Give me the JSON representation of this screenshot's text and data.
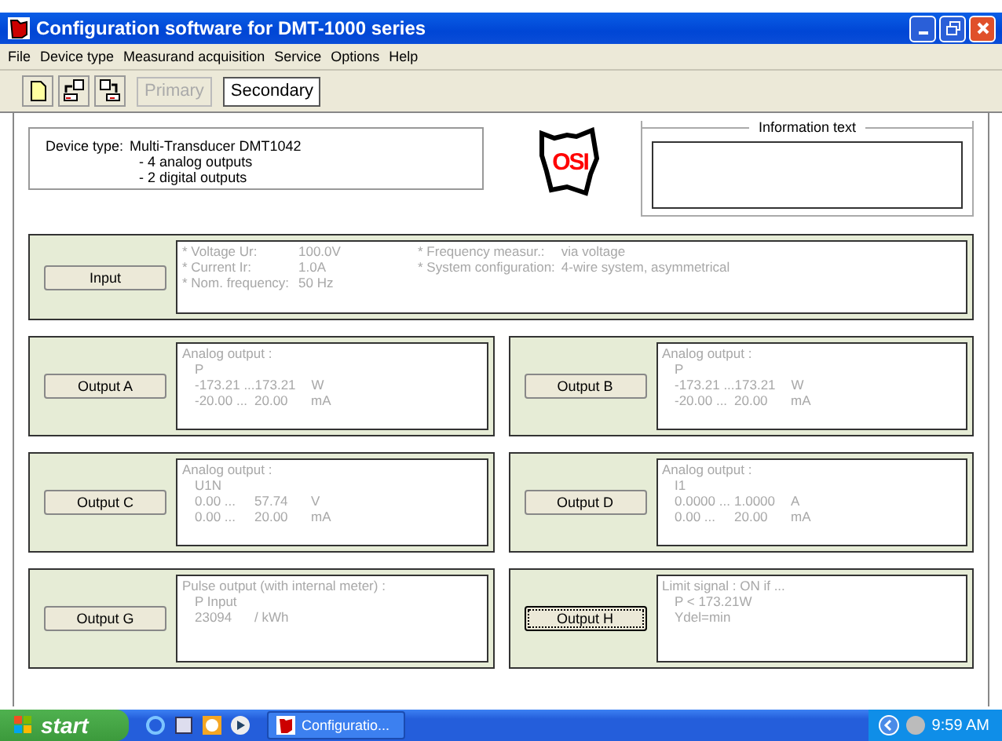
{
  "window": {
    "title": "Configuration software for DMT-1000 series"
  },
  "menu": [
    "File",
    "Device type",
    "Measurand acquisition",
    "Service",
    "Options",
    "Help"
  ],
  "toolbar": {
    "buttons": [
      {
        "label": "Primary",
        "disabled": true
      },
      {
        "label": "Secondary",
        "disabled": false
      }
    ]
  },
  "device": {
    "label": "Device type:",
    "lines": [
      "Multi-Transducer DMT1042",
      "- 4 analog outputs",
      "- 2 digital outputs"
    ]
  },
  "logo": {
    "text": "OSI"
  },
  "information": {
    "title": "Information text"
  },
  "input": {
    "button": "Input",
    "focused": false,
    "left": [
      {
        "label": "* Voltage Ur:",
        "value": "100.0V"
      },
      {
        "label": "* Current Ir:",
        "value": "1.0A"
      },
      {
        "label": "* Nom. frequency:",
        "value": "50 Hz"
      }
    ],
    "right": [
      {
        "label": "* Frequency measur.:",
        "value": "via voltage"
      },
      {
        "label": "* System configuration:",
        "value": "4-wire system, asymmetrical"
      }
    ]
  },
  "outputs": [
    {
      "button": "Output A",
      "focused": false,
      "heading": "Analog output :",
      "lines": [
        [
          "P"
        ],
        [
          "-173.21 ...",
          "173.21",
          "W"
        ],
        [
          "-20.00 ...",
          "20.00",
          "mA"
        ]
      ]
    },
    {
      "button": "Output B",
      "focused": false,
      "heading": "Analog output :",
      "lines": [
        [
          "P"
        ],
        [
          "-173.21 ...",
          "173.21",
          "W"
        ],
        [
          "-20.00 ...",
          "20.00",
          "mA"
        ]
      ]
    },
    {
      "button": "Output C",
      "focused": false,
      "heading": "Analog output :",
      "lines": [
        [
          "U1N"
        ],
        [
          "0.00 ...",
          "57.74",
          "V"
        ],
        [
          "0.00 ...",
          "20.00",
          "mA"
        ]
      ]
    },
    {
      "button": "Output D",
      "focused": false,
      "heading": "Analog output :",
      "lines": [
        [
          "I1"
        ],
        [
          "0.0000 ...",
          "1.0000",
          "A"
        ],
        [
          "0.00 ...",
          "20.00",
          "mA"
        ]
      ]
    },
    {
      "button": "Output G",
      "focused": false,
      "heading": "Pulse output (with internal meter) :",
      "lines": [
        [
          "P Input"
        ],
        [
          "23094",
          "/ kWh"
        ]
      ]
    },
    {
      "button": "Output H",
      "focused": true,
      "heading": "Limit signal :  ON if ...",
      "lines": [
        [
          "P < 173.21W"
        ],
        [
          "Ydel=min"
        ]
      ]
    }
  ],
  "taskbar": {
    "start": "start",
    "tasks": [
      {
        "label": "Configuratio...",
        "selected": false
      }
    ],
    "clock": "9:59 AM"
  }
}
